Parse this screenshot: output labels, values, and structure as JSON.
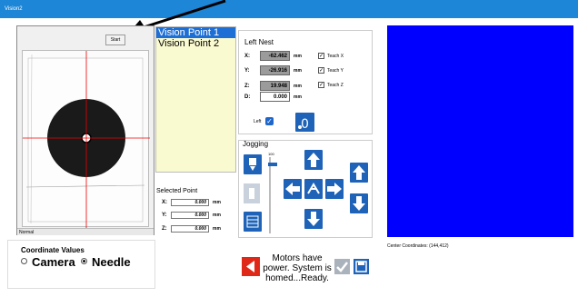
{
  "window": {
    "title": "Vision2"
  },
  "camera": {
    "start_label": "Start",
    "status": "Normal"
  },
  "vision_points": [
    "Vision Point 1",
    "Vision Point 2"
  ],
  "left_nest": {
    "title": "Left Nest",
    "x": {
      "label": "X:",
      "value": "-62.462",
      "unit": "mm"
    },
    "y": {
      "label": "Y:",
      "value": "-26.916",
      "unit": "mm"
    },
    "z": {
      "label": "Z:",
      "value": "19.948",
      "unit": "mm"
    },
    "d": {
      "label": "D:",
      "value": "0.000",
      "unit": "mm"
    },
    "teach_x": "Teach X",
    "teach_y": "Teach Y",
    "teach_z": "Teach Z",
    "left_label": "Left"
  },
  "jogging": {
    "title": "Jogging",
    "speed": "100"
  },
  "selected_point": {
    "title": "Selected Point",
    "x": {
      "label": "X:",
      "value": "0.000",
      "unit": "mm"
    },
    "y": {
      "label": "Y:",
      "value": "0.000",
      "unit": "mm"
    },
    "z": {
      "label": "Z:",
      "value": "0.000",
      "unit": "mm"
    }
  },
  "coordinate_values": {
    "title": "Coordinate Values",
    "camera": "Camera",
    "needle": "Needle",
    "selected": "Needle"
  },
  "center_coordinates": "Center Coordinates: (144,412)",
  "motor_status": "Motors have power. System is homed...Ready.",
  "colors": {
    "titlebar": "#1d86d6",
    "accent": "#1e63b8",
    "video": "#0000ff",
    "stop": "#e02818"
  }
}
